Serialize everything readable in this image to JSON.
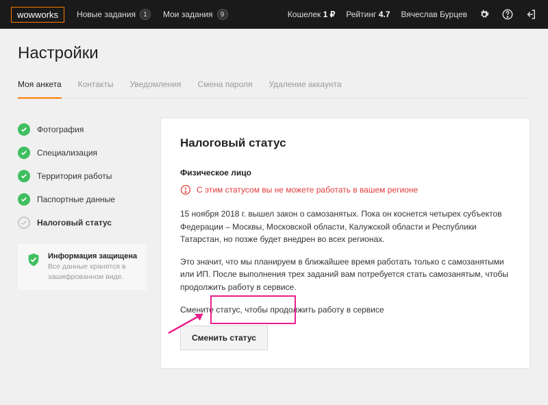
{
  "header": {
    "logo": "wowworks",
    "nav": {
      "new_tasks_label": "Новые задания",
      "new_tasks_count": "1",
      "my_tasks_label": "Мои задания",
      "my_tasks_count": "9"
    },
    "wallet_label": "Кошелек",
    "wallet_value": "1 ₽",
    "rating_label": "Рейтинг",
    "rating_value": "4.7",
    "username": "Вячеслав Бурцев"
  },
  "page_title": "Настройки",
  "tabs": [
    {
      "label": "Моя анкета",
      "active": true
    },
    {
      "label": "Контакты",
      "active": false
    },
    {
      "label": "Уведомления",
      "active": false
    },
    {
      "label": "Смена пароля",
      "active": false
    },
    {
      "label": "Удаление аккаунта",
      "active": false
    }
  ],
  "steps": [
    {
      "label": "Фотография",
      "done": true
    },
    {
      "label": "Специализация",
      "done": true
    },
    {
      "label": "Территория работы",
      "done": true
    },
    {
      "label": "Паспортные данные",
      "done": true
    },
    {
      "label": "Налоговый статус",
      "done": false,
      "current": true
    }
  ],
  "info_box": {
    "title": "Информация защищена",
    "desc": "Все данные хранятся в зашифрованном виде."
  },
  "panel": {
    "heading": "Налоговый статус",
    "subheading": "Физическое лицо",
    "warning": "С этим статусом вы не можете работать в вашем регионе",
    "p1": "15 ноября 2018 г. вышел закон о самозанятых. Пока он коснется четырех субъектов Федерации – Москвы, Московской области, Калужской области и Республики Татарстан, но позже будет внедрен во всех регионах.",
    "p2": "Это значит, что мы планируем в ближайшее время работать только с самозанятыми или ИП. После выполнения трех заданий вам потребуется стать самозанятым, чтобы продолжить работу в сервисе.",
    "p3": "Смените статус, чтобы продолжить работу в сервисе",
    "button": "Сменить статус"
  }
}
